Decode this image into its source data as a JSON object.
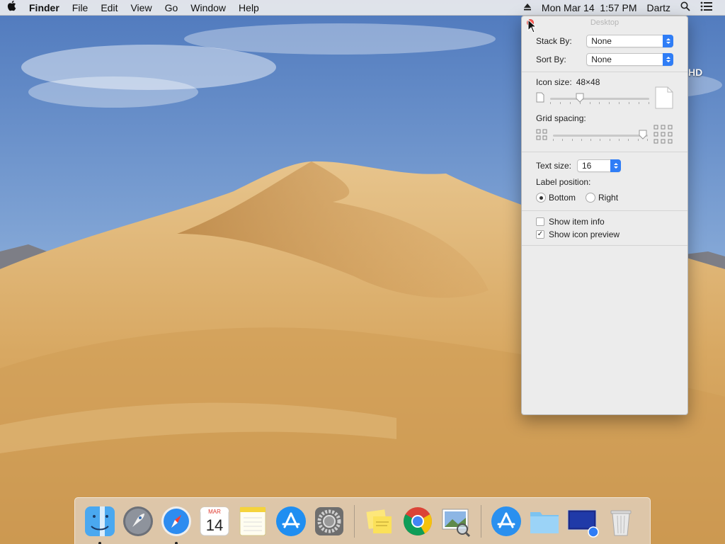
{
  "menubar": {
    "app_name": "Finder",
    "menus": [
      "File",
      "Edit",
      "View",
      "Go",
      "Window",
      "Help"
    ],
    "clock": "Mon Mar 14  1:57 PM",
    "user": "Dartz"
  },
  "desktop": {
    "disk_label": "HD"
  },
  "panel": {
    "title": "Desktop",
    "stack_by_label": "Stack By:",
    "stack_by_value": "None",
    "sort_by_label": "Sort By:",
    "sort_by_value": "None",
    "icon_size_label": "Icon size:",
    "icon_size_value": "48×48",
    "icon_size_level": 0.3,
    "grid_spacing_label": "Grid spacing:",
    "grid_spacing_level": 0.95,
    "text_size_label": "Text size:",
    "text_size_value": "16",
    "label_position_label": "Label position:",
    "label_bottom": "Bottom",
    "label_right": "Right",
    "label_position_selected": "Bottom",
    "show_item_info_label": "Show item info",
    "show_item_info_checked": false,
    "show_icon_preview_label": "Show icon preview",
    "show_icon_preview_checked": true
  },
  "dock": {
    "calendar_month": "MAR",
    "calendar_day": "14"
  }
}
